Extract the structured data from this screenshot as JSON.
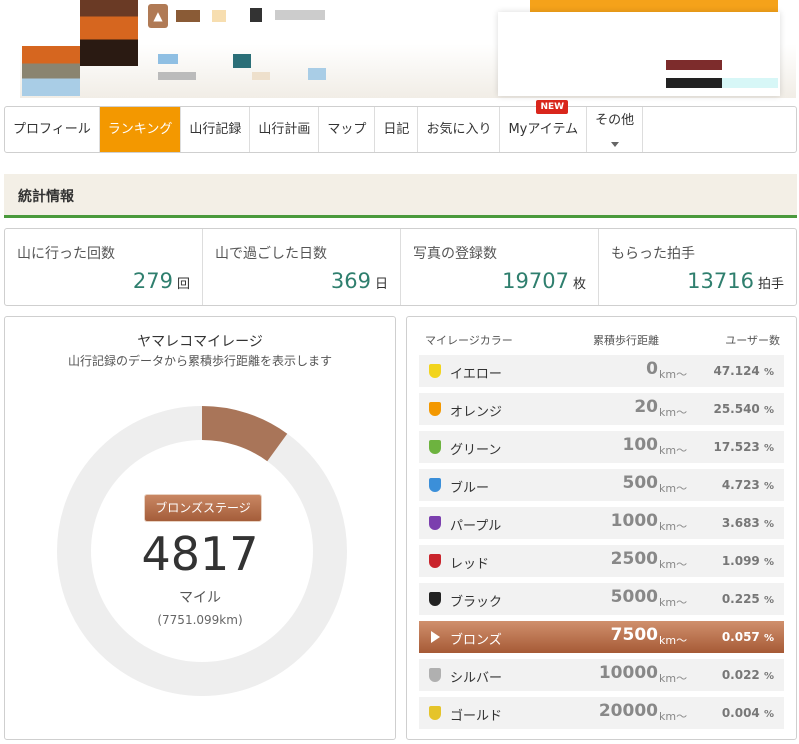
{
  "tabs": [
    {
      "label": "プロフィール"
    },
    {
      "label": "ランキング"
    },
    {
      "label": "山行記録"
    },
    {
      "label": "山行計画"
    },
    {
      "label": "マップ"
    },
    {
      "label": "日記"
    },
    {
      "label": "お気に入り"
    },
    {
      "label": "Myアイテム",
      "badge": "NEW"
    },
    {
      "label": "その他"
    }
  ],
  "section_title": "統計情報",
  "stats": [
    {
      "label": "山に行った回数",
      "value": "279",
      "unit": "回"
    },
    {
      "label": "山で過ごした日数",
      "value": "369",
      "unit": "日"
    },
    {
      "label": "写真の登録数",
      "value": "19707",
      "unit": "枚"
    },
    {
      "label": "もらった拍手",
      "value": "13716",
      "unit": "拍手"
    }
  ],
  "mileage": {
    "title": "ヤマレコマイレージ",
    "subtitle": "山行記録のデータから累積歩行距離を表示します",
    "stage": "ブロンズステージ",
    "value": "4817",
    "unit": "マイル",
    "km": "(7751.099km)",
    "progress_fraction": 0.1,
    "progress_color": "#a97559",
    "track_color": "#eeeeee"
  },
  "table": {
    "headers": {
      "color": "マイレージカラー",
      "distance": "累積歩行距離",
      "users": "ユーザー数"
    },
    "unit": "km〜",
    "rows": [
      {
        "name": "イエロー",
        "distance": "0",
        "pct": "47.124",
        "color": "#f2d41c",
        "active": false
      },
      {
        "name": "オレンジ",
        "distance": "20",
        "pct": "25.540",
        "color": "#f39800",
        "active": false
      },
      {
        "name": "グリーン",
        "distance": "100",
        "pct": "17.523",
        "color": "#6db33f",
        "active": false
      },
      {
        "name": "ブルー",
        "distance": "500",
        "pct": "4.723",
        "color": "#3b8fd9",
        "active": false
      },
      {
        "name": "パープル",
        "distance": "1000",
        "pct": "3.683",
        "color": "#7b3fae",
        "active": false
      },
      {
        "name": "レッド",
        "distance": "2500",
        "pct": "1.099",
        "color": "#c9242c",
        "active": false
      },
      {
        "name": "ブラック",
        "distance": "5000",
        "pct": "0.225",
        "color": "#222222",
        "active": false
      },
      {
        "name": "ブロンズ",
        "distance": "7500",
        "pct": "0.057",
        "color": "#b8714a",
        "active": true
      },
      {
        "name": "シルバー",
        "distance": "10000",
        "pct": "0.022",
        "color": "#b0b0b0",
        "active": false
      },
      {
        "name": "ゴールド",
        "distance": "20000",
        "pct": "0.004",
        "color": "#e5c42a",
        "active": false
      }
    ],
    "pct_unit": "%"
  }
}
